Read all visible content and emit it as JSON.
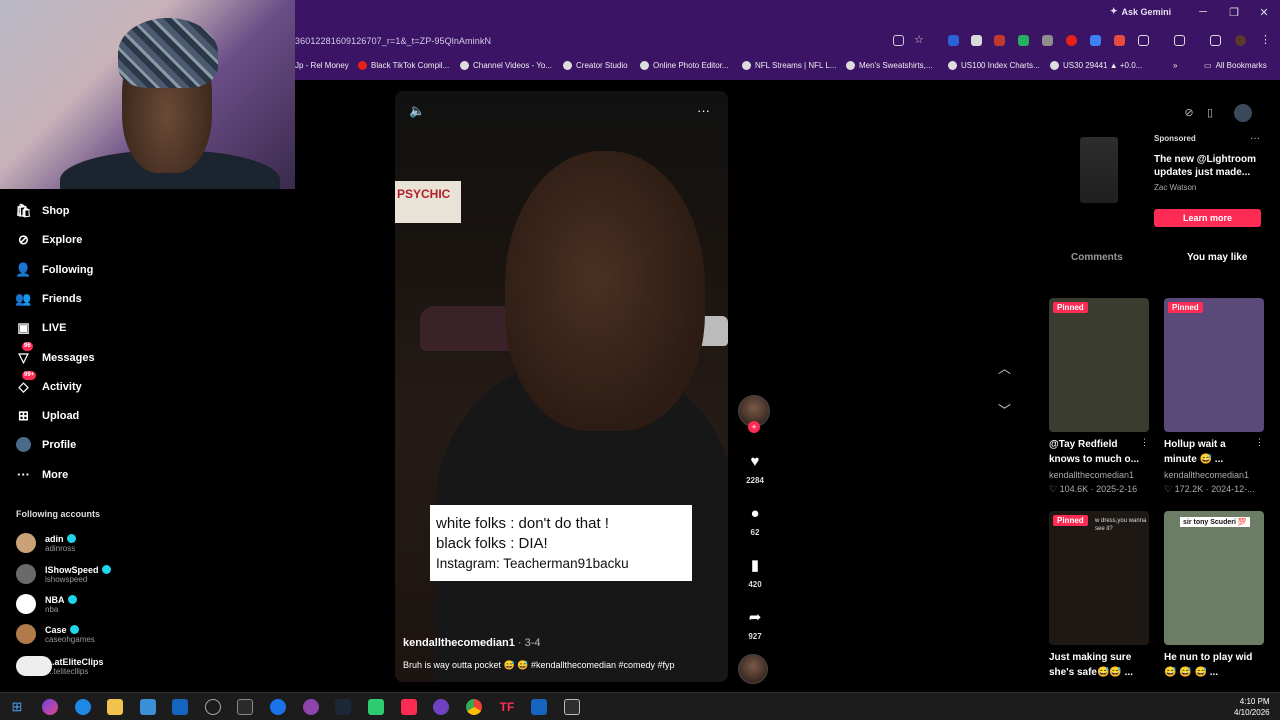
{
  "browser": {
    "ask_gemini": "Ask Gemini",
    "url": "36012281609126707_r=1&_t=ZP-95QlnAminkN",
    "bookmarks": [
      "Jp - Rel Money",
      "Black TikTok Compil...",
      "Channel Videos - Yo...",
      "Creator Studio",
      "Online Photo Editor...",
      "NFL Streams | NFL L...",
      "Men's Sweatshirts,...",
      "US100 Index Charts...",
      "US30 29441 ▲ +0.0..."
    ],
    "all_bookmarks": "All Bookmarks"
  },
  "sidebar": {
    "items": [
      {
        "label": "Shop",
        "icon": "shop-icon"
      },
      {
        "label": "Explore",
        "icon": "compass-icon"
      },
      {
        "label": "Following",
        "icon": "following-icon"
      },
      {
        "label": "Friends",
        "icon": "friends-icon"
      },
      {
        "label": "LIVE",
        "icon": "live-icon"
      },
      {
        "label": "Messages",
        "icon": "messages-icon",
        "badge": "96"
      },
      {
        "label": "Activity",
        "icon": "activity-icon",
        "badge": "99+"
      },
      {
        "label": "Upload",
        "icon": "upload-icon"
      },
      {
        "label": "Profile",
        "icon": "profile-icon"
      },
      {
        "label": "More",
        "icon": "more-icon"
      }
    ],
    "following_title": "Following accounts",
    "accounts": [
      {
        "name": "adin",
        "handle": "adinross"
      },
      {
        "name": "IShowSpeed",
        "handle": "ishowspeed"
      },
      {
        "name": "NBA",
        "handle": "nba"
      },
      {
        "name": "Case",
        "handle": "caseohgames"
      },
      {
        "name": "...atEliteClips",
        "handle": "...telitecllips"
      }
    ]
  },
  "video": {
    "sign_text": "PSYCHIC",
    "caption_lines": [
      "white folks : don't do that !",
      "black folks : DIA!",
      "Instagram: Teacherman91backu"
    ],
    "author": "kendallthecomedian1",
    "date": " · 3-4",
    "description": "Bruh is way outta pocket 😅 😅 #kendallthecomedian #comedy #fyp"
  },
  "actions": {
    "likes": "2284",
    "comments": "62",
    "saves": "420",
    "shares": "927"
  },
  "ad": {
    "sponsored": "Sponsored",
    "title": "The new @Lightroom updates just made...",
    "author": "Zac Watson",
    "cta": "Learn more"
  },
  "tabs": {
    "comments": "Comments",
    "you_may_like": "You may like"
  },
  "recommended": [
    {
      "pinned": "Pinned",
      "title": "@Tay Redfield",
      "title2": "knows to much o...",
      "author": "kendallthecomedian1",
      "stats": "♡ 104.6K · 2025-2-16",
      "overlay": "",
      "bg": "#3a3c30"
    },
    {
      "pinned": "Pinned",
      "title": "Hollup wait a",
      "title2": "minute 😅 ...",
      "author": "kendallthecomedian1",
      "stats": "♡ 172.2K · 2024-12-...",
      "overlay": "",
      "bg": "#5a4a7a"
    },
    {
      "pinned": "Pinned",
      "title": "Just making sure",
      "title2": "she's safe😅😅 ...",
      "author": "",
      "stats": "",
      "overlay": "w dress,you wanna see it?",
      "bg": "#1d1814"
    },
    {
      "pinned": "",
      "title": "He nun to play wid",
      "title2": "😅 😅 😅 ...",
      "author": "",
      "stats": "",
      "overlay": "sir tony Scuderi 💯",
      "bg": "#6c7d66"
    }
  ],
  "taskbar": {
    "time": "4:10 PM",
    "date": "4/10/2026"
  },
  "colors": {
    "browser_bg": "#3b1466",
    "tiktok_red": "#fe2c55",
    "verified": "#20d5ec"
  }
}
